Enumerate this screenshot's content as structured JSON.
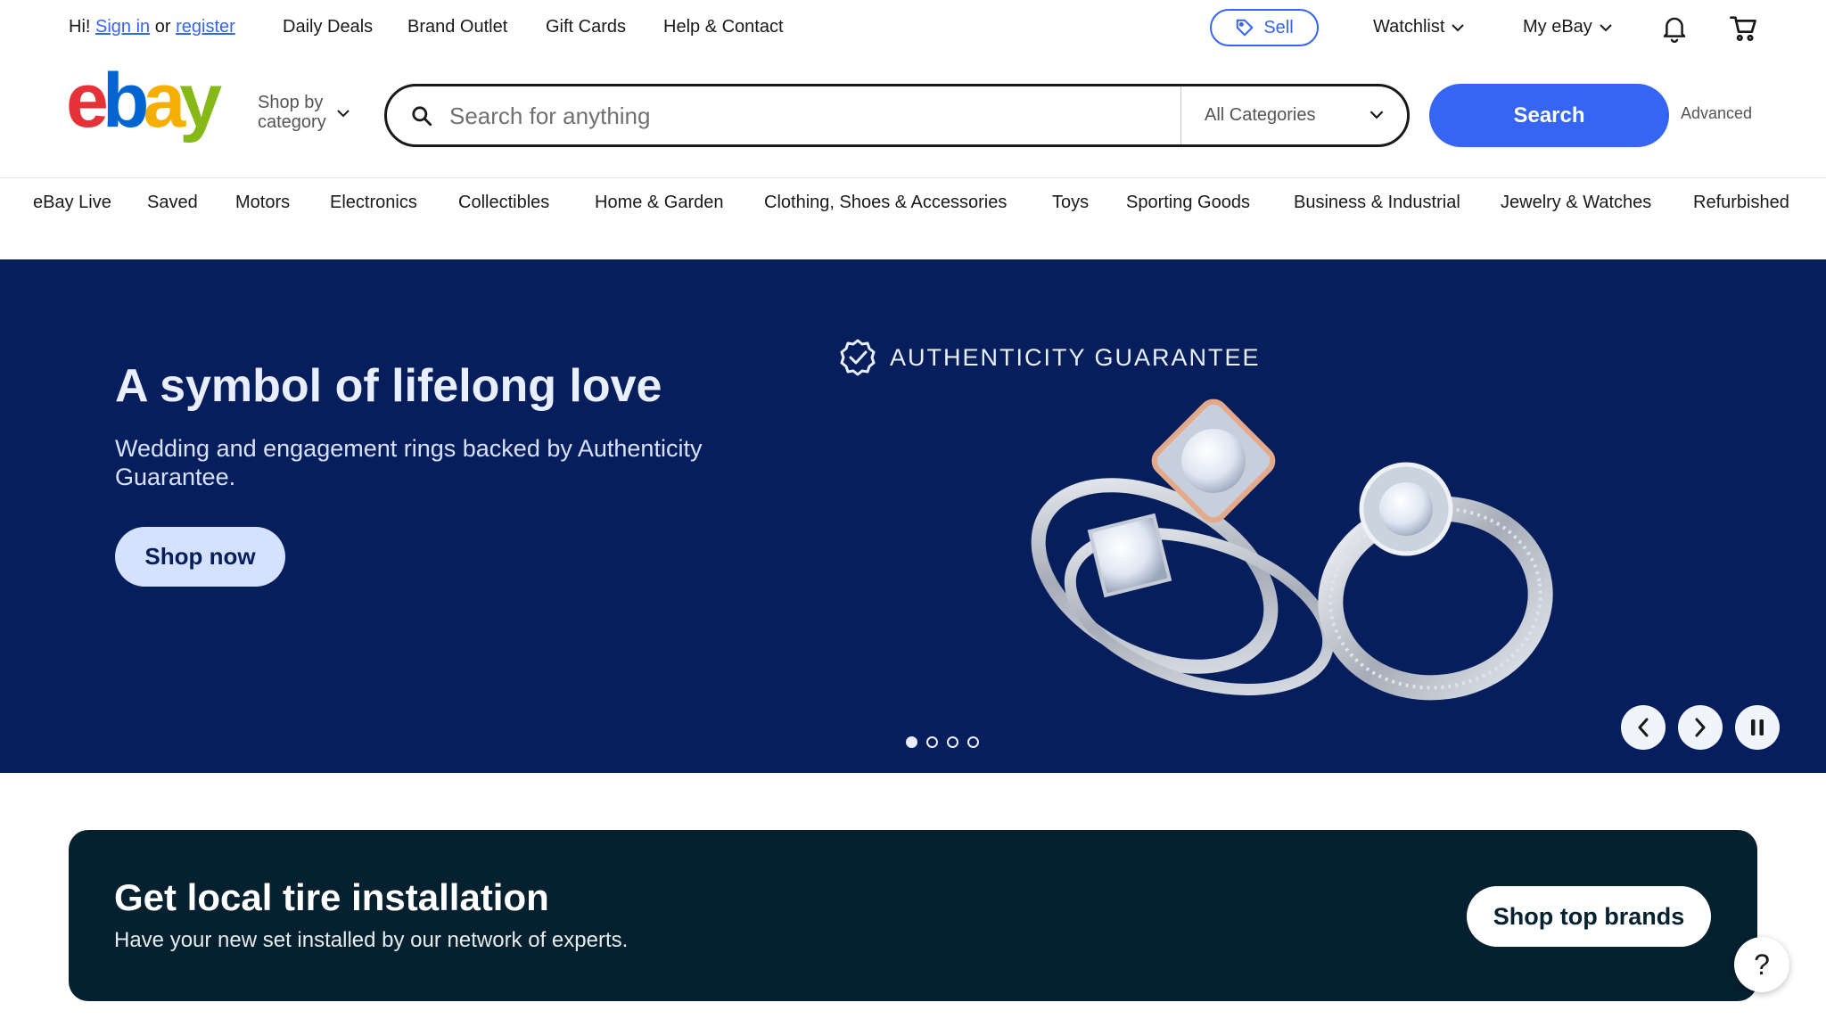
{
  "topbar": {
    "greeting_prefix": "Hi!",
    "sign_in": "Sign in",
    "or": "or",
    "register": "register",
    "links": [
      "Daily Deals",
      "Brand Outlet",
      "Gift Cards",
      "Help & Contact"
    ],
    "sell": "Sell",
    "watchlist": "Watchlist",
    "my_ebay": "My eBay"
  },
  "header": {
    "shop_by_line1": "Shop by",
    "shop_by_line2": "category",
    "search_placeholder": "Search for anything",
    "category_selected": "All Categories",
    "search_button": "Search",
    "advanced": "Advanced"
  },
  "nav": {
    "items": [
      "eBay Live",
      "Saved",
      "Motors",
      "Electronics",
      "Collectibles",
      "Home & Garden",
      "Clothing, Shoes & Accessories",
      "Toys",
      "Sporting Goods",
      "Business & Industrial",
      "Jewelry & Watches",
      "Refurbished"
    ]
  },
  "hero": {
    "title": "A symbol of lifelong love",
    "subtitle": "Wedding and engagement rings backed by Authenticity Guarantee.",
    "button": "Shop now",
    "badge": "AUTHENTICITY GUARANTEE",
    "slide_index": 1,
    "slide_count": 4
  },
  "tire": {
    "title": "Get local tire installation",
    "subtitle": "Have your new set installed by our network of experts.",
    "button": "Shop top brands"
  },
  "help": {
    "label": "?"
  },
  "colors": {
    "brand_blue": "#3665f3",
    "hero_bg": "#061f5c",
    "tire_bg": "#05202e",
    "logo_red": "#e53238",
    "logo_blue": "#0064d2",
    "logo_yellow": "#f5af02",
    "logo_green": "#86b817"
  }
}
